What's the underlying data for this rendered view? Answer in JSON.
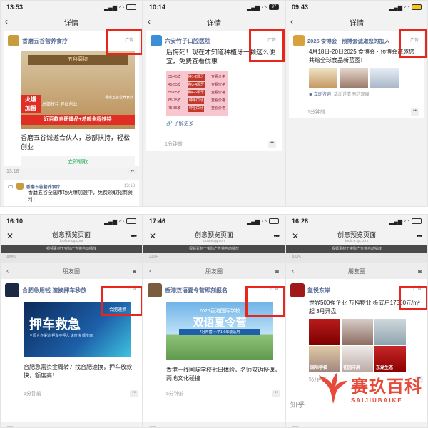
{
  "colors": {
    "ad_highlight": "#e8261c",
    "link_blue": "#576b95",
    "green": "#07a346"
  },
  "screens": [
    {
      "time": "13:53",
      "title": "详情",
      "brand": "香磨五谷营养食疗",
      "ad_tag": "广告",
      "image_text": {
        "top_banner": "五谷磨坊",
        "badge_top": "火爆",
        "badge_bottom": "加盟",
        "line1": "总部扶持 轻松创业",
        "line2": "近百款自研爆品+总部全程扶持",
        "side": "香磨五谷营养食疗"
      },
      "body": "香磨五谷诚邀合伙人，总部扶持，轻松创业",
      "button": "立即领取",
      "time_ago": "13:18",
      "dots": "••",
      "comment": {
        "name": "香磨五谷营养食疗",
        "time": "13:18",
        "text": "香磨五谷全国市场火爆加盟中，免费领取招商资料！"
      }
    },
    {
      "time": "10:14",
      "battery": "97",
      "title": "详情",
      "brand": "六安竹子口腔医院",
      "ad_tag": "广告",
      "body": "后悔死！现在才知道种植牙一颗这么便宜，免费查看优惠",
      "price_rows": [
        {
          "age": "35-45岁",
          "plan": "种1-2颗牙",
          "link": "查看价格"
        },
        {
          "age": "45-55岁",
          "plan": "种3-4颗牙",
          "link": "查看价格"
        },
        {
          "age": "55-65岁",
          "plan": "种4-6颗牙",
          "link": "查看价格"
        },
        {
          "age": "65-75岁",
          "plan": "种半口牙",
          "link": "查看价格"
        },
        {
          "age": "75-85岁",
          "plan": "种全口牙",
          "link": "查看价格"
        }
      ],
      "more": "了解更多",
      "time_ago": "1分钟前",
      "dots": "••"
    },
    {
      "time": "09:43",
      "title": "详情",
      "brand": "2025 食博会 · 预博会诚邀您的加入",
      "ad_tag": "广告",
      "body": "4月18日-20日2025 食博会 · 预博会诚邀您共绘全球食品新蓝图！",
      "consult": "立即咨询",
      "links": "活动详情  预约观展",
      "time_ago": "1分钟前",
      "dots": "••"
    },
    {
      "time": "16:10",
      "page_title": "创意预览页面",
      "page_sub": "tools.e.qq.com",
      "tip": "视频素材于实际广告将自动播放",
      "ams": "AMS",
      "moments": "朋友圈",
      "brand": "合肥急用钱 速换押车秒放",
      "ad_tag": "广告",
      "image_text": {
        "main": "押车救急",
        "corner": "合肥速换",
        "small": "全国合作渠道 押车不押人 速度快 额度高"
      },
      "body": "合肥急需资金周转？找合肥速换，押车放款快，额度高！",
      "time_ago": "5分钟前",
      "dots": "••",
      "next": "网信"
    },
    {
      "time": "17:46",
      "page_title": "创意预览页面",
      "page_sub": "tools.e.qq.com",
      "tip": "视频素材于实际广告将自动播放",
      "ams": "AMS",
      "moments": "朋友圈",
      "brand": "香港双语夏令营即刻报名",
      "ad_tag": "广告",
      "image_text": {
        "top": "2025香港国际学校",
        "main": "双语夏令营",
        "sub": "7月开营  小学1-6年级适用"
      },
      "body": "香港一线国际学校七日体验，名师双语授课，两地文化碰撞",
      "time_ago": "5分钟前",
      "dots": "••",
      "next": "网信"
    },
    {
      "time": "16:28",
      "page_title": "创意预览页面",
      "page_sub": "tools.e.qq.com",
      "tip": "视频素材于实际广告将自动播放",
      "ams": "AMS",
      "moments": "朋友圈",
      "brand": "玺悦东岸",
      "ad_tag": "广告",
      "body": "世界500强企业 万科物业 板式户17300元/m²起 3月开盘",
      "thumbs": [
        "国际学校",
        "花园洋房",
        "东湖生态"
      ],
      "time_ago": "5分钟前",
      "dots": "••",
      "next": "网信"
    }
  ],
  "watermark": {
    "cn": "赛玖百科",
    "en": "SAIJIUBAIKE",
    "zhi": "知乎"
  }
}
